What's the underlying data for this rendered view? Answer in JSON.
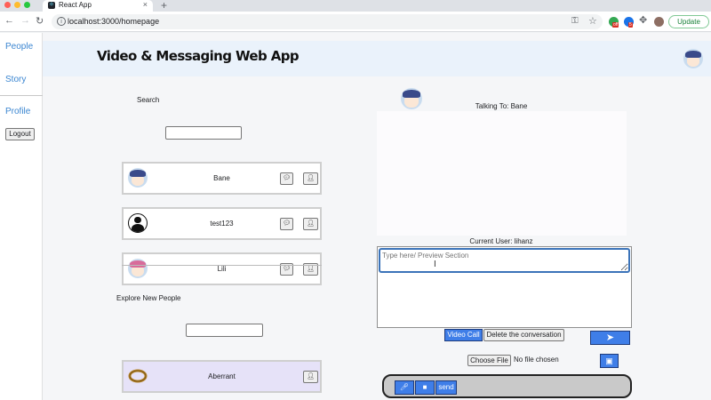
{
  "browser": {
    "tab_title": "React App",
    "tab_favicon": "react-icon",
    "url": "localhost:3000/homepage",
    "update_label": "Update",
    "new_tab": "+",
    "close_tab": "×"
  },
  "sidebar": {
    "items": [
      {
        "label": "People"
      },
      {
        "label": "Story"
      },
      {
        "label": "Profile"
      }
    ],
    "logout_label": "Logout"
  },
  "header": {
    "title": "Video & Messaging Web App"
  },
  "people": {
    "search_label": "Search",
    "search_value": "",
    "contacts": [
      {
        "name": "Bane",
        "avatar": "cartoon-avatar"
      },
      {
        "name": "test123",
        "avatar": "default-user-avatar"
      },
      {
        "name": "Lili",
        "avatar": "cartoon-avatar-pink"
      }
    ],
    "explore_label": "Explore New People",
    "explore_value": "",
    "explore_results": [
      {
        "name": "Aberrant",
        "avatar": "ring-avatar"
      }
    ]
  },
  "chat": {
    "talking_to": "Talking To: Bane",
    "current_user": "Current User: lihanz",
    "message_placeholder": "Type here/ Preview Section",
    "video_call_label": "Video Call",
    "delete_label": "Delete the conversation",
    "choose_file_label": "Choose File",
    "file_status": "No file chosen",
    "send_audio_label": "send"
  },
  "colors": {
    "accent_blue": "#3f7ee8",
    "link_blue": "#3b86d1",
    "header_bg": "#eaf2fb",
    "explore_card_bg": "#e6e2f8"
  }
}
